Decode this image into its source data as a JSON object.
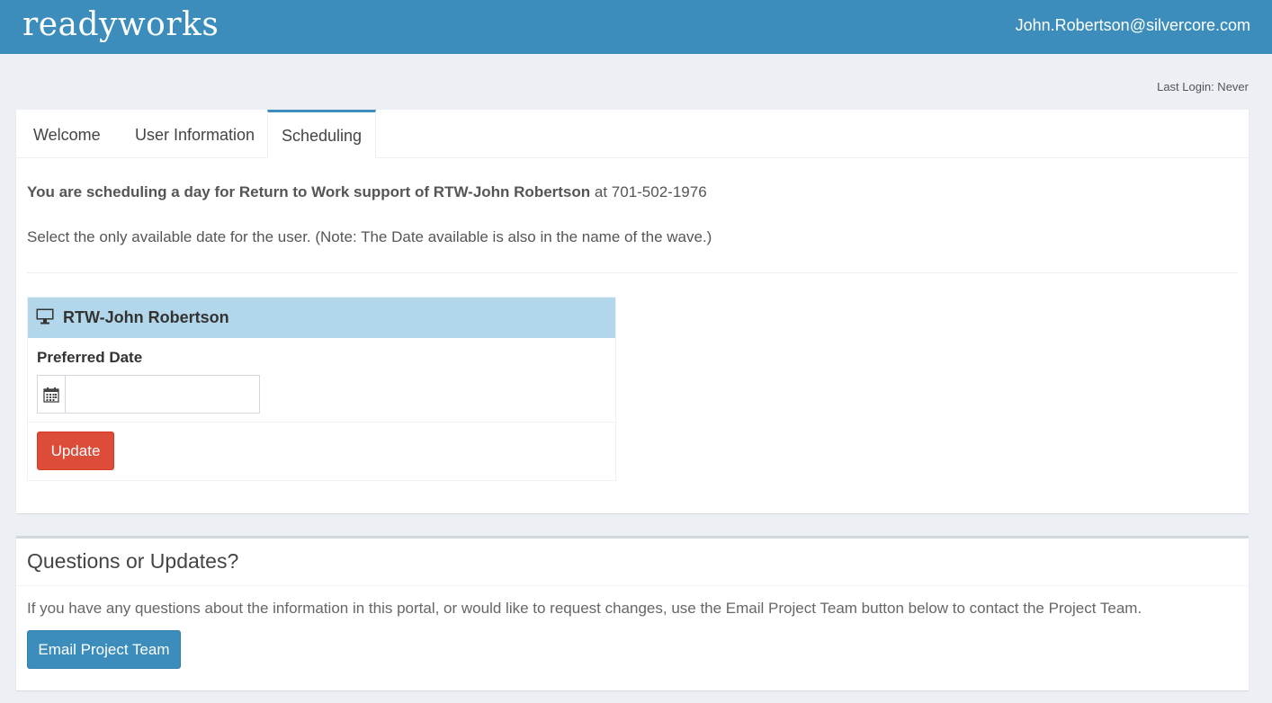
{
  "header": {
    "logo_text": "readyworks",
    "user_email": "John.Robertson@silvercore.com",
    "brand_color": "#3c8dbc"
  },
  "last_login": "Last Login: Never",
  "tabs": [
    {
      "label": "Welcome",
      "active": false
    },
    {
      "label": "User Information",
      "active": false
    },
    {
      "label": "Scheduling",
      "active": true
    }
  ],
  "scheduling": {
    "intro_bold": "You are scheduling a day for Return to Work support of RTW-John Robertson",
    "intro_rest": " at 701-502-1976",
    "instruction": "Select the only available date for the user. (Note: The Date available is also in the name of the wave.)",
    "device": {
      "icon": "desktop-icon",
      "name": "RTW-John Robertson"
    },
    "preferred_date_label": "Preferred Date",
    "preferred_date_value": "",
    "calendar_icon": "calendar-icon",
    "update_label": "Update",
    "update_color": "#dd4b39"
  },
  "questions": {
    "title": "Questions or Updates?",
    "text": "If you have any questions about the information in this portal, or would like to request changes, use the Email Project Team button below to contact the Project Team.",
    "button_label": "Email Project Team"
  }
}
